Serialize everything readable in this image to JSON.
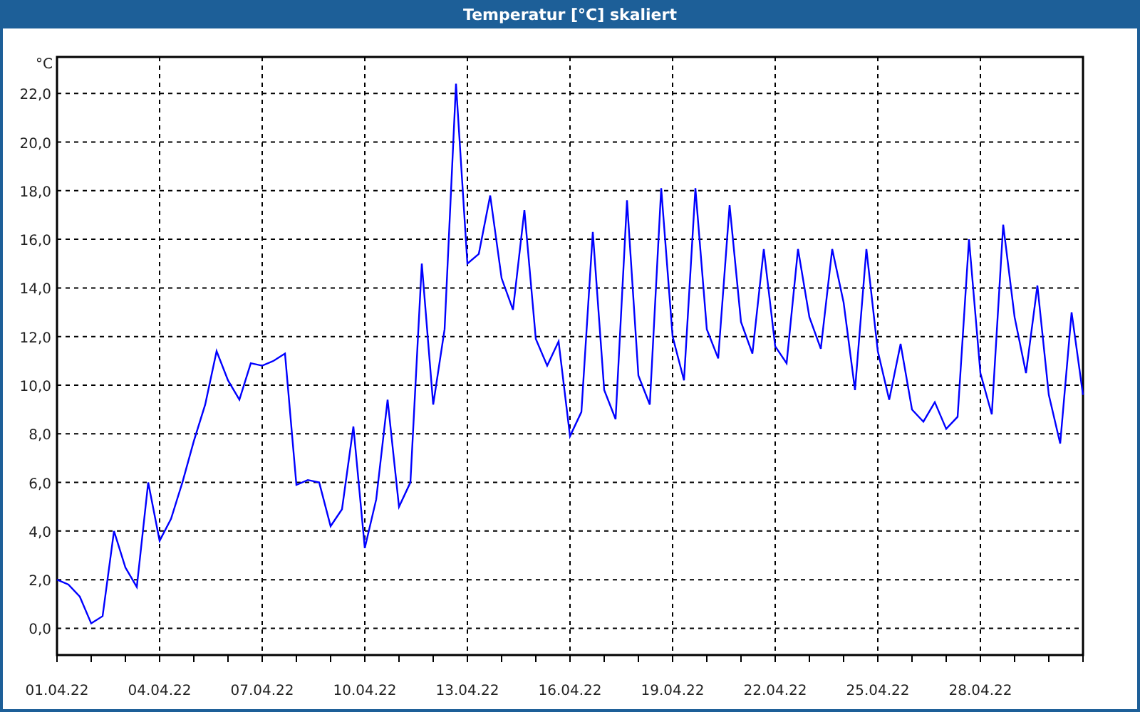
{
  "window": {
    "title": "Temperatur [°C] skaliert"
  },
  "chart": {
    "chart_data": {
      "type": "line",
      "grid": true,
      "ylabel": "°C",
      "ylim": [
        -1.1,
        23.5
      ],
      "yticks": [
        {
          "value": 0,
          "label": "0,0"
        },
        {
          "value": 2,
          "label": "2,0"
        },
        {
          "value": 4,
          "label": "4,0"
        },
        {
          "value": 6,
          "label": "6,0"
        },
        {
          "value": 8,
          "label": "8,0"
        },
        {
          "value": 10,
          "label": "10,0"
        },
        {
          "value": 12,
          "label": "12,0"
        },
        {
          "value": 14,
          "label": "14,0"
        },
        {
          "value": 16,
          "label": "16,0"
        },
        {
          "value": 18,
          "label": "18,0"
        },
        {
          "value": 20,
          "label": "20,0"
        },
        {
          "value": 22,
          "label": "22,0"
        }
      ],
      "categories": [
        "01.04.22",
        null,
        null,
        null,
        null,
        null,
        null,
        null,
        null,
        "04.04.22",
        null,
        null,
        null,
        null,
        null,
        null,
        null,
        null,
        "07.04.22",
        null,
        null,
        null,
        null,
        null,
        null,
        null,
        null,
        "10.04.22",
        null,
        null,
        null,
        null,
        null,
        null,
        null,
        null,
        "13.04.22",
        null,
        null,
        null,
        null,
        null,
        null,
        null,
        null,
        "16.04.22",
        null,
        null,
        null,
        null,
        null,
        null,
        null,
        null,
        "19.04.22",
        null,
        null,
        null,
        null,
        null,
        null,
        null,
        null,
        "22.04.22",
        null,
        null,
        null,
        null,
        null,
        null,
        null,
        null,
        "25.04.22",
        null,
        null,
        null,
        null,
        null,
        null,
        null,
        null,
        "28.04.22",
        null,
        null,
        null,
        null,
        null,
        null,
        null,
        null,
        null
      ],
      "series": [
        {
          "color": "#0000ff",
          "values": [
            2.0,
            1.8,
            1.3,
            0.2,
            0.5,
            4.0,
            2.5,
            1.7,
            6.0,
            3.6,
            4.5,
            6.0,
            7.7,
            9.2,
            11.4,
            10.2,
            9.4,
            10.9,
            10.8,
            11.0,
            11.3,
            5.9,
            6.1,
            6.0,
            4.2,
            4.9,
            8.3,
            3.3,
            5.3,
            9.4,
            5.0,
            6.0,
            15.0,
            9.2,
            12.3,
            22.4,
            15.0,
            15.4,
            17.8,
            14.4,
            13.1,
            17.2,
            11.9,
            10.8,
            11.8,
            7.9,
            8.9,
            16.3,
            9.8,
            8.6,
            17.6,
            10.4,
            9.2,
            18.1,
            12.0,
            10.2,
            18.1,
            12.3,
            11.1,
            17.4,
            12.6,
            11.3,
            15.6,
            11.6,
            10.9,
            15.6,
            12.8,
            11.5,
            15.6,
            13.4,
            9.8,
            15.6,
            11.4,
            9.4,
            11.7,
            9.0,
            8.5,
            9.3,
            8.2,
            8.7,
            16.0,
            10.5,
            8.8,
            16.6,
            12.8,
            10.5,
            14.1,
            9.6,
            7.6,
            13.0,
            9.6
          ]
        }
      ]
    }
  }
}
